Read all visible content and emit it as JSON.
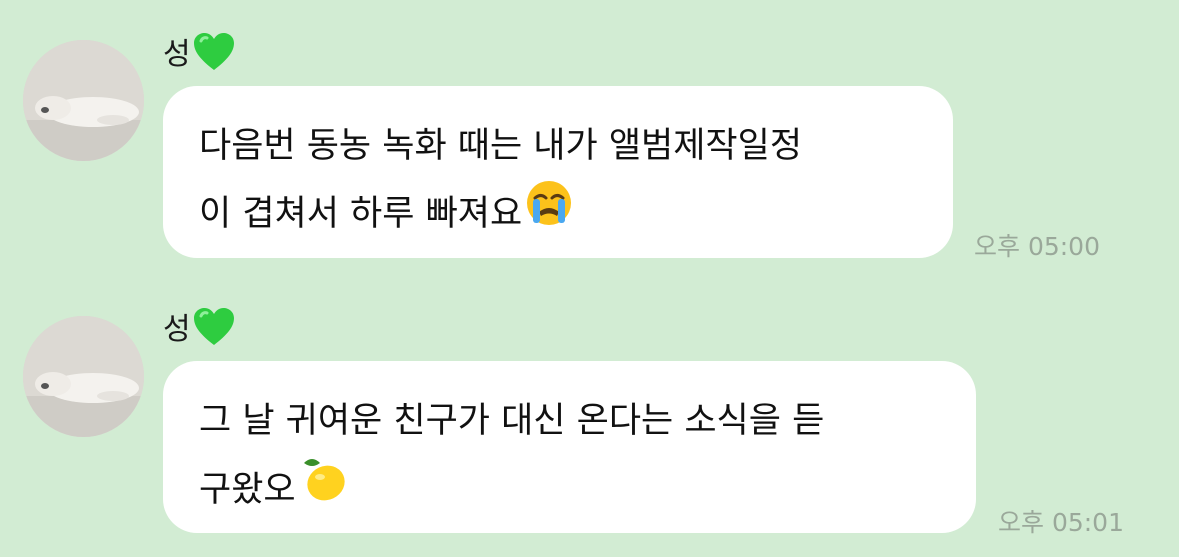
{
  "messages": [
    {
      "sender": "성",
      "lines": [
        "다음번 동농 녹화 때는 내가 앨범제작일정",
        "이 겹쳐서 하루 빠져요"
      ],
      "emoji_icon": "loudly-crying-face-emoji",
      "time": "오후 05:00"
    },
    {
      "sender": "성",
      "lines": [
        "그 날 귀여운 친구가 대신 온다는 소식을 듣",
        "구왔오"
      ],
      "emoji_icon": "lemon-emoji",
      "time": "오후 05:01"
    }
  ],
  "sender_badge_icon": "green-heart-icon",
  "colors": {
    "background": "#d2ecd3",
    "bubble": "#ffffff",
    "heart": "#2ecc40",
    "time_text": "#9aa89a"
  }
}
